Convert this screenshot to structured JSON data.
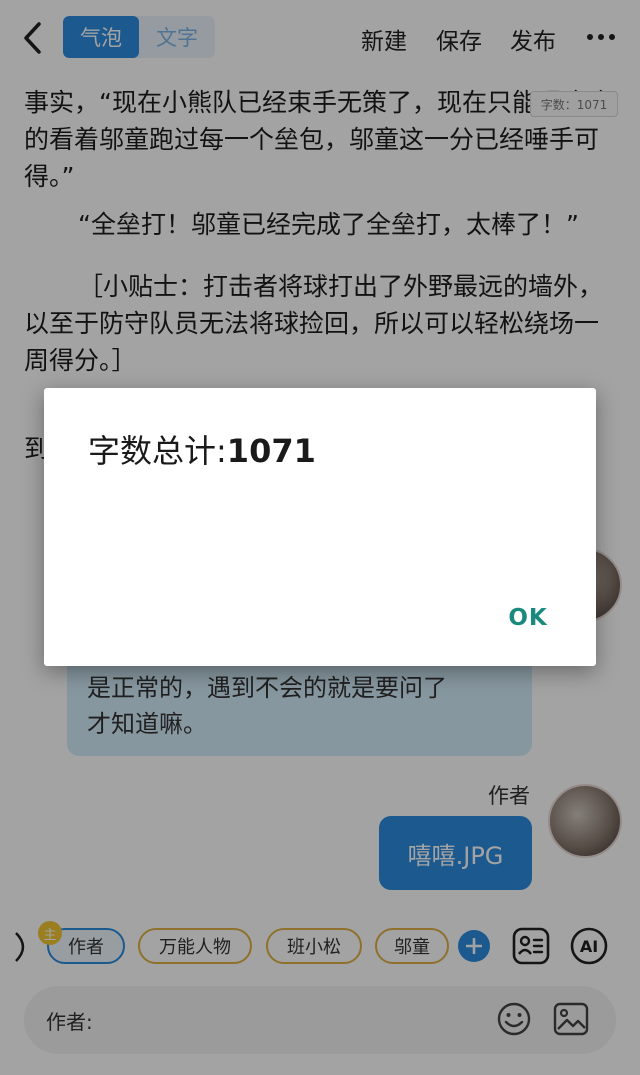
{
  "header": {
    "mode_tabs": [
      {
        "label": "气泡",
        "active": true
      },
      {
        "label": "文字",
        "active": false
      }
    ],
    "actions": {
      "new_label": "新建",
      "save_label": "保存",
      "publish_label": "发布"
    },
    "icons": {
      "back": "chevron-left-icon",
      "more": "more-horizontal-icon"
    }
  },
  "document": {
    "word_badge": "字数：1071",
    "paragraphs": [
      "事实，“现在小熊队已经束手无策了，现在只能眼睁睁的看着邬童跑过每一个垒包，邬童这一分已经唾手可得。”",
      "“全垒打！邬童已经完成了全垒打，太棒了！”",
      "［小贴士：打击者将球打出了外野最远的墙外，以至于防守队员无法将球捡回，所以可以轻松绕场一周得分。］",
      "到"
    ]
  },
  "chat": {
    "left_bubble_text": "是正常的，遇到不会的就是要问了\n才知道嘛。",
    "right_speaker": "作者",
    "right_bubble_text": "嘻嘻.JPG"
  },
  "roles": {
    "main_badge": "主",
    "chips": [
      "作者",
      "万能人物",
      "班小松",
      "邬童"
    ],
    "active_index": 0,
    "add_icon": "plus-icon",
    "tool_icons": [
      "contact-card-icon",
      "ai-icon"
    ],
    "ai_label": "AI"
  },
  "input": {
    "prefix": "作者:",
    "icons": [
      "emoji-icon",
      "image-icon"
    ]
  },
  "dialog": {
    "title_prefix": "字数总计:",
    "count": "1071",
    "ok_label": "OK"
  },
  "colors": {
    "accent": "#2b8ce0",
    "dialog_button": "#1b8a7e",
    "chip_border": "#e0b046"
  }
}
